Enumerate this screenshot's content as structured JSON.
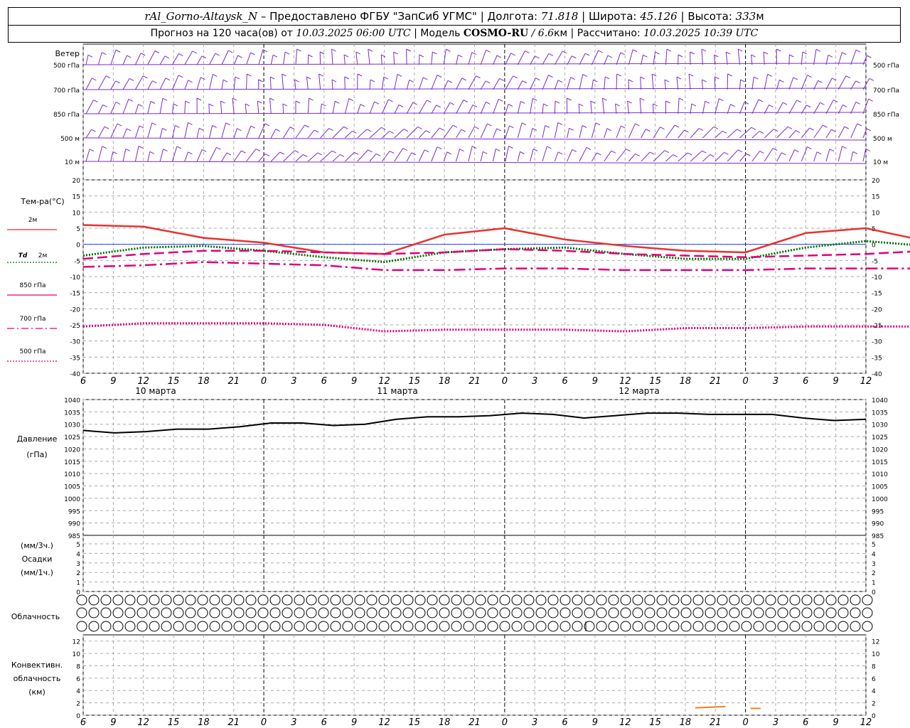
{
  "header": {
    "station": "rAl_Gorno-Altaysk_N",
    "provided_by": "– Предоставлено ФГБУ \"ЗапСиб УГМС\"",
    "lon_label": "Долгота:",
    "lon_value": "71.818",
    "lat_label": "Широта:",
    "lat_value": "45.126",
    "alt_label": "Высота:",
    "alt_value": "333",
    "alt_unit": "м",
    "forecast_label": "Прогноз на 120 часа(ов) от",
    "forecast_time": "10.03.2025 06:00 UTC",
    "model_label": "Модель",
    "model_name": "COSMO-RU",
    "model_res": "/ 6.6",
    "model_res_unit": "км",
    "calc_label": "Рассчитано:",
    "calc_time": "10.03.2025 10:39 UTC"
  },
  "chart_data": [
    {
      "type": "wind-barbs",
      "label": "Ветер",
      "levels": [
        "500 гПа",
        "700 гПа",
        "850 гПа",
        "500 м",
        "10 м"
      ]
    },
    {
      "type": "line",
      "label": "Тем-ра(°С)",
      "ylim": [
        -40,
        20
      ],
      "yticks": [
        20,
        15,
        10,
        5,
        0,
        -5,
        -10,
        -15,
        -20,
        -25,
        -30,
        -35,
        -40
      ],
      "x_hours": [
        0,
        6,
        12,
        18,
        24,
        30,
        36,
        42,
        48,
        54,
        60,
        66,
        72,
        78,
        84
      ],
      "series": [
        {
          "name": "2м",
          "color": "#e8322c",
          "dash": "solid",
          "values": [
            6,
            5.5,
            2,
            0.5,
            -2.5,
            -3,
            3,
            5,
            1.5,
            -0.5,
            -2,
            -2.5,
            3.5,
            5,
            1
          ]
        },
        {
          "name": "Td 2м",
          "color": "#007000",
          "dash": "dot",
          "values": [
            -3.5,
            -1,
            -0.5,
            -2,
            -4,
            -5.5,
            -2.5,
            -1.5,
            -1,
            -3,
            -4.5,
            -4.5,
            -1,
            1,
            -0.5
          ]
        },
        {
          "name": "850 гПа",
          "color": "#e0007a",
          "dash": "dash",
          "values": [
            -4.5,
            -3,
            -2,
            -2,
            -2.5,
            -3,
            -2.5,
            -1.5,
            -2,
            -3,
            -3.5,
            -4,
            -3.5,
            -3,
            -2
          ]
        },
        {
          "name": "700 гПа",
          "color": "#e0007a",
          "dash": "dashdot",
          "values": [
            -7,
            -6.5,
            -5.5,
            -6,
            -6.5,
            -8,
            -8,
            -7.5,
            -7.5,
            -8,
            -8,
            -8,
            -7.5,
            -7.5,
            -7.5
          ]
        },
        {
          "name": "500 гПа",
          "color": "#e0007a",
          "dash": "dot",
          "values": [
            -25.5,
            -24.5,
            -24.5,
            -24.5,
            -25,
            -27,
            -26.5,
            -26.5,
            -26.5,
            -27,
            -26,
            -26,
            -25.5,
            -25.5,
            -25.5
          ]
        }
      ]
    },
    {
      "type": "line",
      "label": "Давление",
      "unit": "(гПа)",
      "ylim": [
        985,
        1040
      ],
      "yticks": [
        1040,
        1035,
        1030,
        1025,
        1020,
        1015,
        1010,
        1005,
        1000,
        995,
        990,
        985
      ],
      "series": [
        {
          "name": "",
          "color": "#000000",
          "values": [
            1027.5,
            1026.5,
            1027,
            1028,
            1028,
            1029,
            1030.5,
            1030.5,
            1029.5,
            1030,
            1032,
            1033,
            1033,
            1033.5,
            1034.5,
            1034,
            1032.5,
            1033.5,
            1034.5,
            1034.5,
            1034,
            1034,
            1034,
            1032.5,
            1031.5,
            1032
          ]
        }
      ]
    },
    {
      "type": "bar",
      "label": "Осадки",
      "unit_top": "(мм/3ч.)",
      "unit_bottom": "(мм/1ч.)",
      "ylim": [
        0,
        5
      ],
      "yticks": [
        5,
        4,
        3,
        2,
        1,
        0
      ],
      "values": []
    },
    {
      "type": "symbols",
      "label": "Облачность",
      "rows": 3,
      "symbol": "○"
    },
    {
      "type": "line",
      "label": "Конвективн. облачность (км)",
      "label_lines": [
        "Конвективн.",
        "облачность",
        "(км)"
      ],
      "ylim": [
        0,
        13
      ],
      "yticks": [
        12,
        10,
        8,
        6,
        4,
        2,
        0
      ],
      "series": [
        {
          "name": "",
          "color": "#f08020",
          "segments": [
            [
              [
                61,
                1.2
              ],
              [
                64,
                1.4
              ]
            ],
            [
              [
                66.5,
                1.1
              ],
              [
                67.5,
                1.1
              ]
            ]
          ]
        }
      ]
    }
  ],
  "x_axis": {
    "tick_labels": [
      "6",
      "9",
      "12",
      "15",
      "18",
      "21",
      "0",
      "3",
      "6",
      "9",
      "12",
      "15",
      "18",
      "21",
      "0",
      "3",
      "6",
      "9",
      "12",
      "15",
      "18",
      "21",
      "0",
      "3",
      "6",
      "9",
      "12"
    ],
    "days": [
      "10 марта",
      "11 марта",
      "12 марта"
    ]
  },
  "legend": {
    "t2m": "2м",
    "td_prefix": "Td",
    "td_suffix": "2м",
    "p850": "850 гПа",
    "p700": "700 гПа",
    "p500": "500 гПа"
  }
}
